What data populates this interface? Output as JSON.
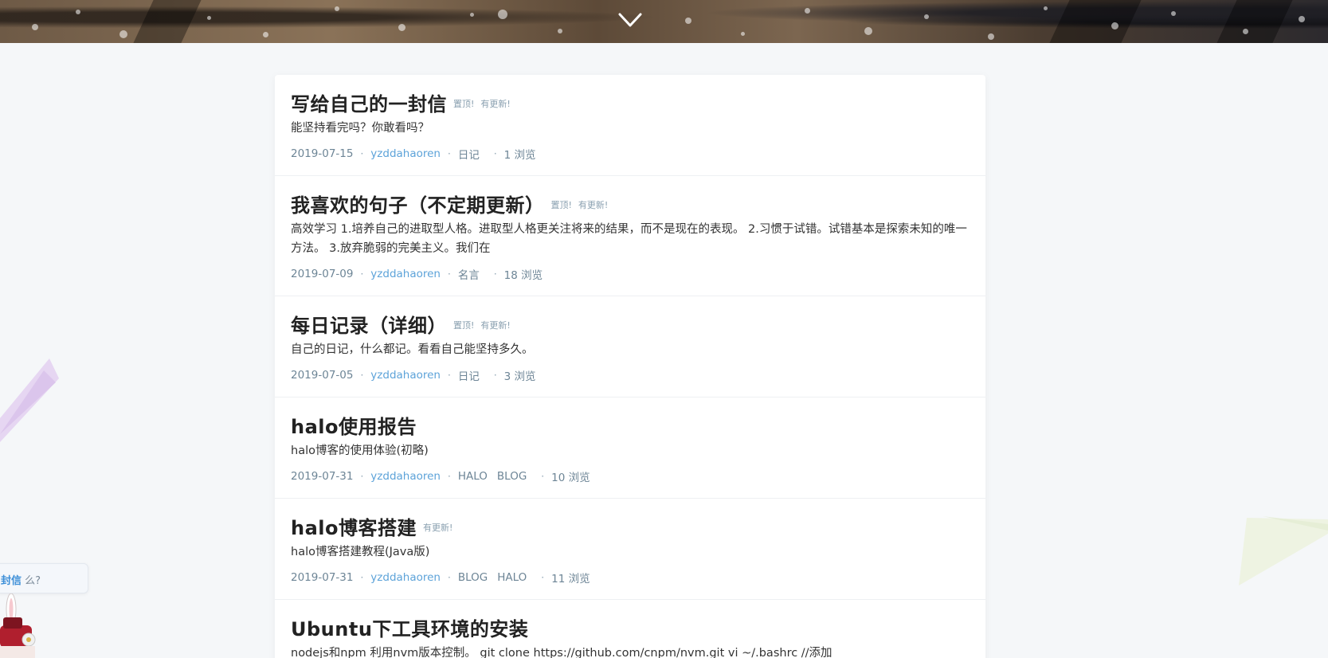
{
  "hero": {
    "scroll_icon": "chevron-down-icon"
  },
  "posts": [
    {
      "title": "写给自己的一封信",
      "tags": [
        "置顶!",
        "有更新!"
      ],
      "excerpt": "能坚持看完吗？你敢看吗？",
      "date": "2019-07-15",
      "author": "yzddahaoren",
      "categories": [
        "日记"
      ],
      "views": "1 浏览"
    },
    {
      "title": "我喜欢的句子（不定期更新）",
      "tags": [
        "置顶!",
        "有更新!"
      ],
      "excerpt": "高效学习 1.培养自己的进取型人格。进取型人格更关注将来的结果，而不是现在的表现。 2.习惯于试错。试错基本是探索未知的唯一方法。 3.放弃脆弱的完美主义。我们在",
      "date": "2019-07-09",
      "author": "yzddahaoren",
      "categories": [
        "名言"
      ],
      "views": "18 浏览"
    },
    {
      "title": "每日记录（详细）",
      "tags": [
        "置顶!",
        "有更新!"
      ],
      "excerpt": "自己的日记，什么都记。看看自己能坚持多久。",
      "date": "2019-07-05",
      "author": "yzddahaoren",
      "categories": [
        "日记"
      ],
      "views": "3 浏览"
    },
    {
      "title": "halo使用报告",
      "tags": [],
      "excerpt": "halo博客的使用体验(初略)",
      "date": "2019-07-31",
      "author": "yzddahaoren",
      "categories": [
        "HALO",
        "BLOG"
      ],
      "views": "10 浏览"
    },
    {
      "title": "halo博客搭建",
      "tags": [
        "有更新!"
      ],
      "excerpt": "halo博客搭建教程(Java版)",
      "date": "2019-07-31",
      "author": "yzddahaoren",
      "categories": [
        "BLOG",
        "HALO"
      ],
      "views": "11 浏览"
    },
    {
      "title": "Ubuntu下工具环境的安装",
      "tags": [],
      "excerpt": "nodejs和npm 利用nvm版本控制。 git clone https://github.com/cnpm/nvm.git vi ~/.bashrc //添加",
      "date": "",
      "author": "",
      "categories": [],
      "views": ""
    }
  ],
  "mascot": {
    "bubble_link": "封信",
    "bubble_suffix": " 么?"
  },
  "colors": {
    "author": "#5da3d9",
    "meta": "#6d8596",
    "tag": "#8aa0b0"
  }
}
